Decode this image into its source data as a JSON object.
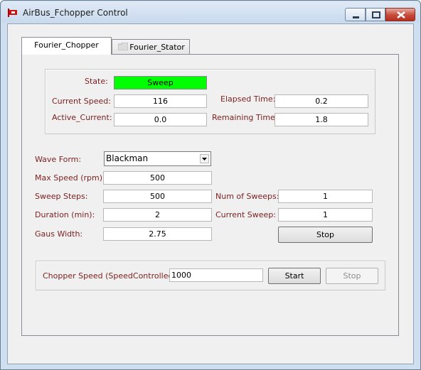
{
  "window": {
    "title": "AirBus_Fchopper Control"
  },
  "tabs": [
    {
      "label": "Fourier_Chopper"
    },
    {
      "label": "Fourier_Stator"
    }
  ],
  "status": {
    "state_label": "State:",
    "state_value": "Sweep",
    "current_speed_label": "Current Speed:",
    "current_speed_value": "116",
    "active_current_label": "Active_Current:",
    "active_current_value": "0.0",
    "elapsed_time_label": "Elapsed Time:",
    "elapsed_time_value": "0.2",
    "remaining_time_label": "Remaining Time:",
    "remaining_time_value": "1.8"
  },
  "settings": {
    "wave_form_label": "Wave Form:",
    "wave_form_value": "Blackman",
    "max_speed_label": "Max Speed (rpm):",
    "max_speed_value": "500",
    "sweep_steps_label": "Sweep Steps:",
    "sweep_steps_value": "500",
    "duration_label": "Duration (min):",
    "duration_value": "2",
    "gaus_width_label": "Gaus Width:",
    "gaus_width_value": "2.75",
    "num_sweeps_label": "Num of Sweeps:",
    "num_sweeps_value": "1",
    "current_sweep_label": "Current Sweep:",
    "current_sweep_value": "1",
    "stop_label": "Stop"
  },
  "chopper": {
    "speed_label": "Chopper Speed (SpeedControlled):",
    "speed_value": "1000",
    "start_label": "Start",
    "stop_label": "Stop"
  },
  "colors": {
    "state_active": "#00ff00",
    "label_maroon": "#7a1f1f"
  }
}
